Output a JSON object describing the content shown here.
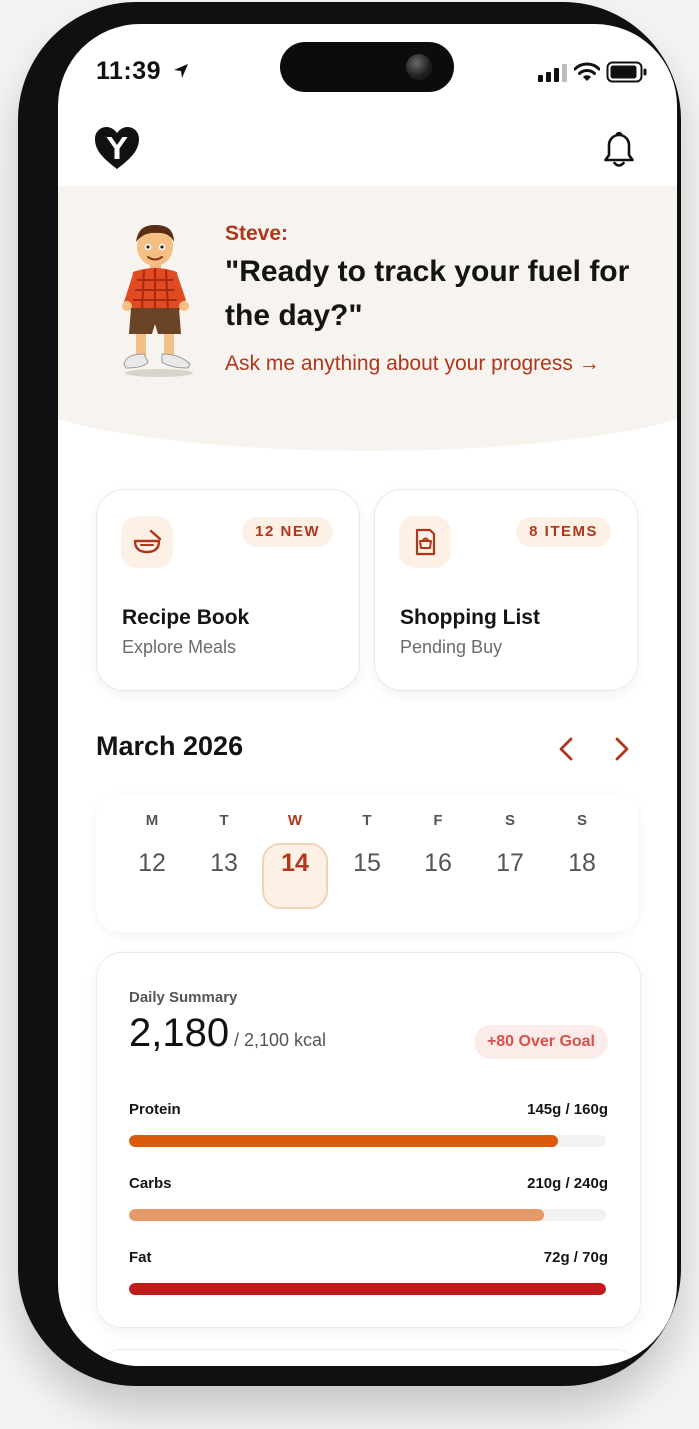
{
  "status_bar": {
    "time": "11:39"
  },
  "icons": {
    "logo": "logo-heart-y-icon",
    "notifications": "bell-icon",
    "location": "location-arrow-icon",
    "signal": "signal-icon",
    "wifi": "wifi-icon",
    "battery": "battery-icon",
    "recipe": "bowl-icon",
    "shopping": "receipt-icon",
    "prev": "chevron-left-icon",
    "next": "chevron-right-icon"
  },
  "coach": {
    "name": "Steve:",
    "message": "\"Ready to track your fuel for the day?\"",
    "link": "Ask me anything about your progress →"
  },
  "cards": [
    {
      "badge": "12 NEW",
      "title": "Recipe Book",
      "subtitle": "Explore Meals"
    },
    {
      "badge": "8 ITEMS",
      "title": "Shopping List",
      "subtitle": "Pending Buy"
    }
  ],
  "calendar": {
    "month": "March 2026",
    "days": [
      {
        "dow": "M",
        "num": "12"
      },
      {
        "dow": "T",
        "num": "13"
      },
      {
        "dow": "W",
        "num": "14",
        "selected": true
      },
      {
        "dow": "T",
        "num": "15"
      },
      {
        "dow": "F",
        "num": "16"
      },
      {
        "dow": "S",
        "num": "17"
      },
      {
        "dow": "S",
        "num": "18"
      }
    ]
  },
  "summary": {
    "label": "Daily Summary",
    "calories": "2,180",
    "goal": "/ 2,100 kcal",
    "badge": "+80 Over Goal",
    "macros": [
      {
        "name": "Protein",
        "value": "145g / 160g",
        "fraction": 0.9,
        "color": "#db5b0d"
      },
      {
        "name": "Carbs",
        "value": "210g / 240g",
        "fraction": 0.87,
        "color": "#e49966"
      },
      {
        "name": "Fat",
        "value": "72g / 70g",
        "fraction": 1.0,
        "color": "#c01c1c"
      }
    ]
  },
  "colors": {
    "accent": "#b0361c",
    "header_bg": "#f7f4ef",
    "badge_bg": "#fdf1e6",
    "over_badge_text": "#d8514b"
  }
}
